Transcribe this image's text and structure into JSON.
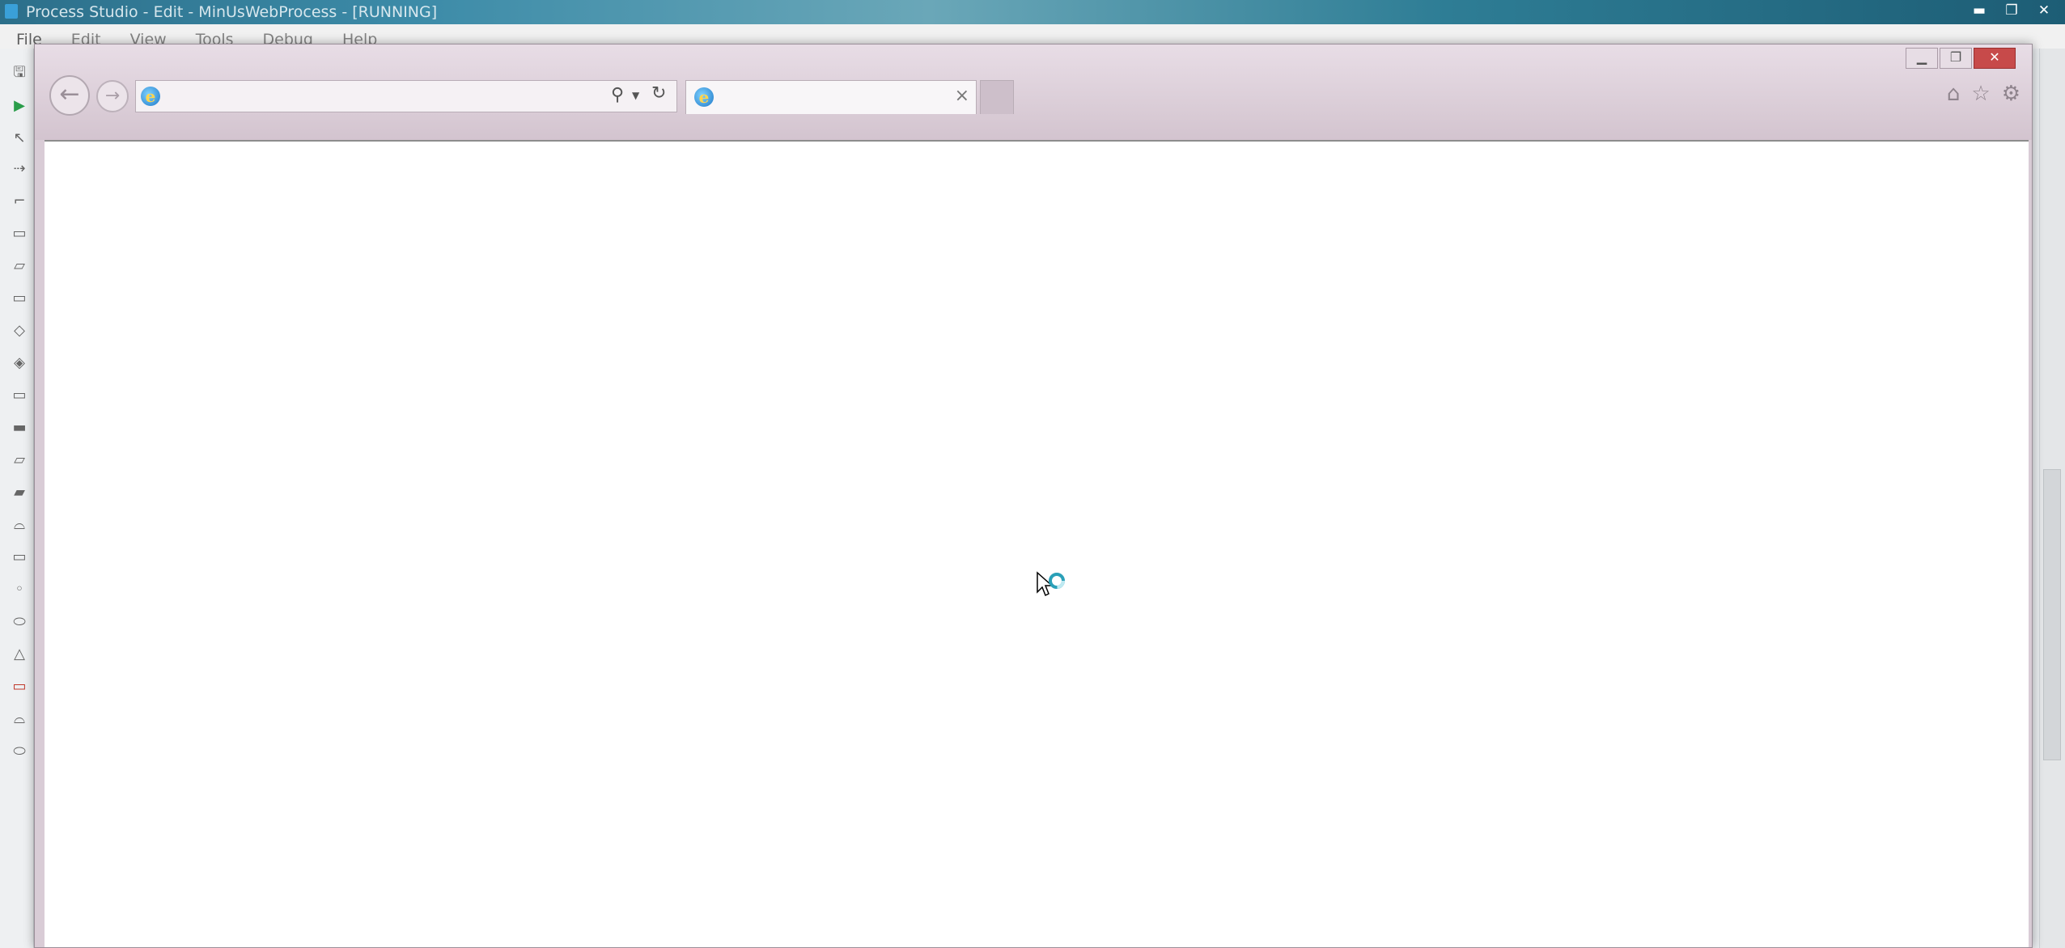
{
  "process_studio": {
    "title": "Process Studio  - Edit - MinUsWebProcess - [RUNNING]",
    "menu": [
      "File",
      "Edit",
      "View",
      "Tools",
      "Debug",
      "Help"
    ],
    "window_controls": [
      "minimize",
      "restore",
      "close"
    ]
  },
  "browser": {
    "address": {
      "value": "",
      "placeholder": ""
    },
    "tab": {
      "title": "",
      "close": "×"
    },
    "icons": [
      "home-icon",
      "favorites-star-icon",
      "settings-gear-icon"
    ],
    "window_controls": [
      "minimize",
      "restore",
      "close"
    ]
  },
  "cursor": {
    "state": "busy"
  },
  "colors": {
    "accent": "#2c6f8a",
    "browser_frame": "#d9ccd6",
    "close_red": "#c74a4a"
  }
}
